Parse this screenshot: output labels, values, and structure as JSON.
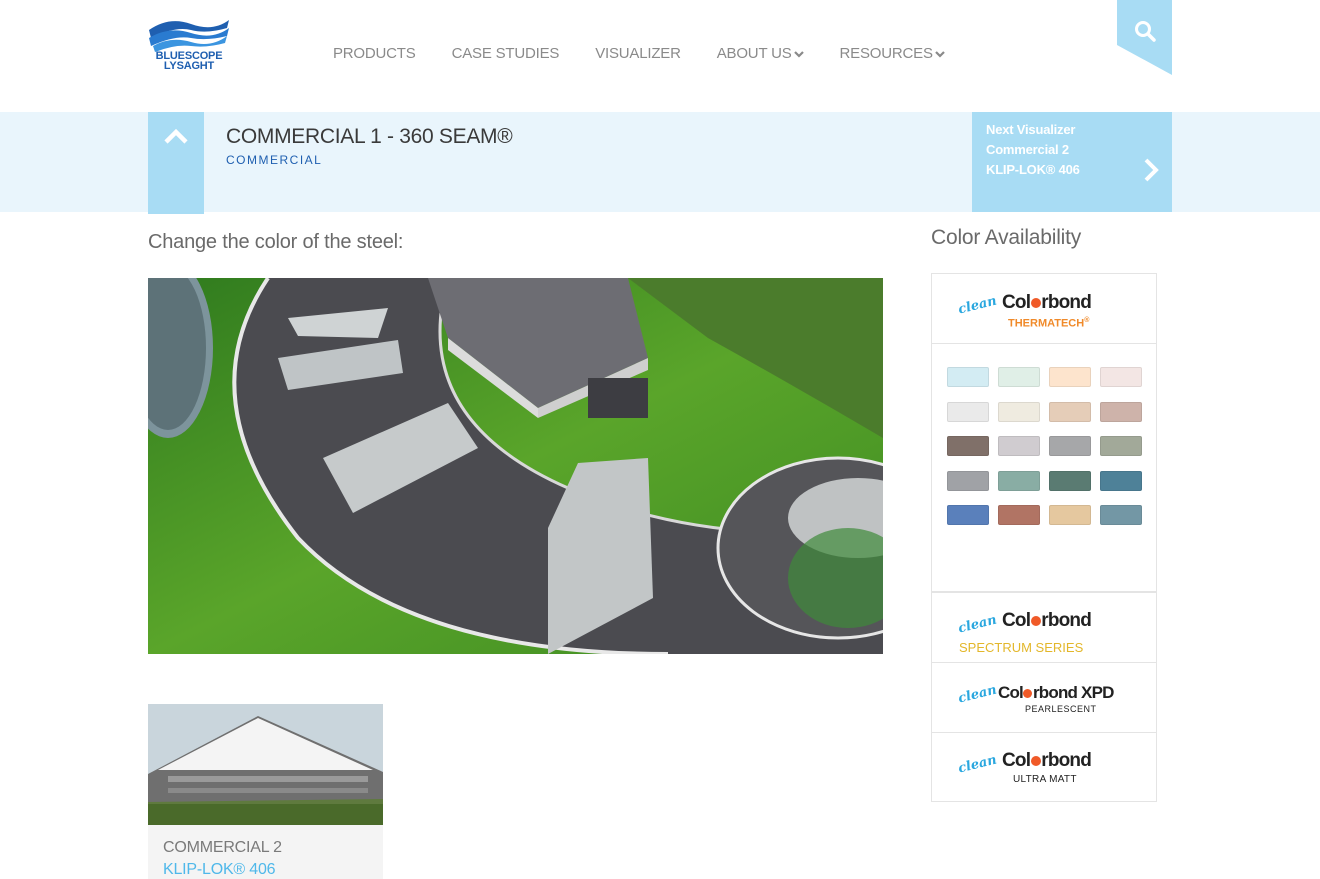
{
  "logo": {
    "line1": "BLUESCOPE",
    "line2": "LYSAGHT"
  },
  "nav": {
    "items": [
      {
        "label": "PRODUCTS",
        "dropdown": false
      },
      {
        "label": "CASE STUDIES",
        "dropdown": false
      },
      {
        "label": "VISUALIZER",
        "dropdown": false
      },
      {
        "label": "ABOUT US",
        "dropdown": true
      },
      {
        "label": "RESOURCES",
        "dropdown": true
      }
    ]
  },
  "header": {
    "title": "COMMERCIAL 1 - 360 SEAM®",
    "category": "COMMERCIAL"
  },
  "next_visualizer": {
    "line1": "Next Visualizer",
    "line2": "Commercial 2",
    "line3": "KLIP-LOK® 406"
  },
  "main": {
    "change_label": "Change the color of the steel:"
  },
  "related": {
    "title": "COMMERCIAL 2",
    "subtitle": "KLIP-LOK® 406"
  },
  "sidebar": {
    "title": "Color Availability",
    "clean_label": "clean",
    "brand": "Colorbond",
    "thermatech": {
      "sub": "THERMATECH",
      "sub_mark": "®"
    },
    "spectrum": {
      "sub": "SPECTRUM SERIES"
    },
    "xpd": {
      "brand": "Colorbond XPD",
      "sub": "PEARLESCENT"
    },
    "ultra": {
      "sub": "ULTRA MATT"
    },
    "swatches": [
      "#d3ecf3",
      "#e0efe7",
      "#fde4cd",
      "#f3e6e4",
      "#eaeaea",
      "#efebe0",
      "#e5cdb8",
      "#ceb3aa",
      "#807069",
      "#d0ccd0",
      "#a6a7a9",
      "#a2a999",
      "#a0a2a6",
      "#89ada4",
      "#5a7b72",
      "#4e8198",
      "#5a80bb",
      "#b17464",
      "#e5c89f",
      "#7397a5"
    ]
  },
  "colors": {
    "accent": "#a8dcf4",
    "band": "#e9f5fc",
    "brand_blue": "#1f5fb0",
    "link_blue": "#4fb8ea",
    "colorbond_orange": "#f05a28"
  }
}
